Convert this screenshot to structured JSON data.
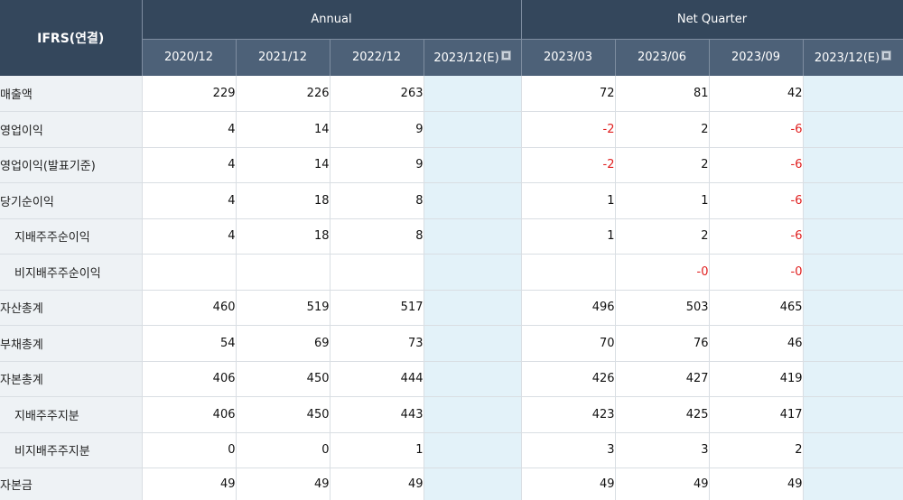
{
  "header": {
    "corner": "IFRS(연결)",
    "annual_label": "Annual",
    "quarter_label": "Net Quarter",
    "annual_periods": [
      "2020/12",
      "2021/12",
      "2022/12",
      "2023/12(E)"
    ],
    "quarter_periods": [
      "2023/03",
      "2023/06",
      "2023/09",
      "2023/12(E)"
    ]
  },
  "rows": [
    {
      "label": "매출액",
      "sub": false,
      "annual": [
        "229",
        "226",
        "263",
        ""
      ],
      "quarter": [
        "72",
        "81",
        "42",
        ""
      ]
    },
    {
      "label": "영업이익",
      "sub": false,
      "annual": [
        "4",
        "14",
        "9",
        ""
      ],
      "quarter": [
        "-2",
        "2",
        "-6",
        ""
      ]
    },
    {
      "label": "영업이익(발표기준)",
      "sub": false,
      "annual": [
        "4",
        "14",
        "9",
        ""
      ],
      "quarter": [
        "-2",
        "2",
        "-6",
        ""
      ]
    },
    {
      "label": "당기순이익",
      "sub": false,
      "annual": [
        "4",
        "18",
        "8",
        ""
      ],
      "quarter": [
        "1",
        "1",
        "-6",
        ""
      ]
    },
    {
      "label": "지배주주순이익",
      "sub": true,
      "annual": [
        "4",
        "18",
        "8",
        ""
      ],
      "quarter": [
        "1",
        "2",
        "-6",
        ""
      ]
    },
    {
      "label": "비지배주주순이익",
      "sub": true,
      "annual": [
        "",
        "",
        "",
        ""
      ],
      "quarter": [
        "",
        "-0",
        "-0",
        ""
      ]
    },
    {
      "label": "자산총계",
      "sub": false,
      "annual": [
        "460",
        "519",
        "517",
        ""
      ],
      "quarter": [
        "496",
        "503",
        "465",
        ""
      ]
    },
    {
      "label": "부채총계",
      "sub": false,
      "annual": [
        "54",
        "69",
        "73",
        ""
      ],
      "quarter": [
        "70",
        "76",
        "46",
        ""
      ]
    },
    {
      "label": "자본총계",
      "sub": false,
      "annual": [
        "406",
        "450",
        "444",
        ""
      ],
      "quarter": [
        "426",
        "427",
        "419",
        ""
      ]
    },
    {
      "label": "지배주주지분",
      "sub": true,
      "annual": [
        "406",
        "450",
        "443",
        ""
      ],
      "quarter": [
        "423",
        "425",
        "417",
        ""
      ]
    },
    {
      "label": "비지배주주지분",
      "sub": true,
      "annual": [
        "0",
        "0",
        "1",
        ""
      ],
      "quarter": [
        "3",
        "3",
        "2",
        ""
      ]
    },
    {
      "label": "자본금",
      "sub": false,
      "annual": [
        "49",
        "49",
        "49",
        ""
      ],
      "quarter": [
        "49",
        "49",
        "49",
        ""
      ]
    }
  ],
  "colors": {
    "header_dark": "#34475c",
    "header_period": "#4d6178",
    "label_bg": "#eef2f5",
    "estimate_bg": "#e3f2f9",
    "negative": "#e02020"
  },
  "icons": {
    "estimate": "estimate-info-icon"
  }
}
